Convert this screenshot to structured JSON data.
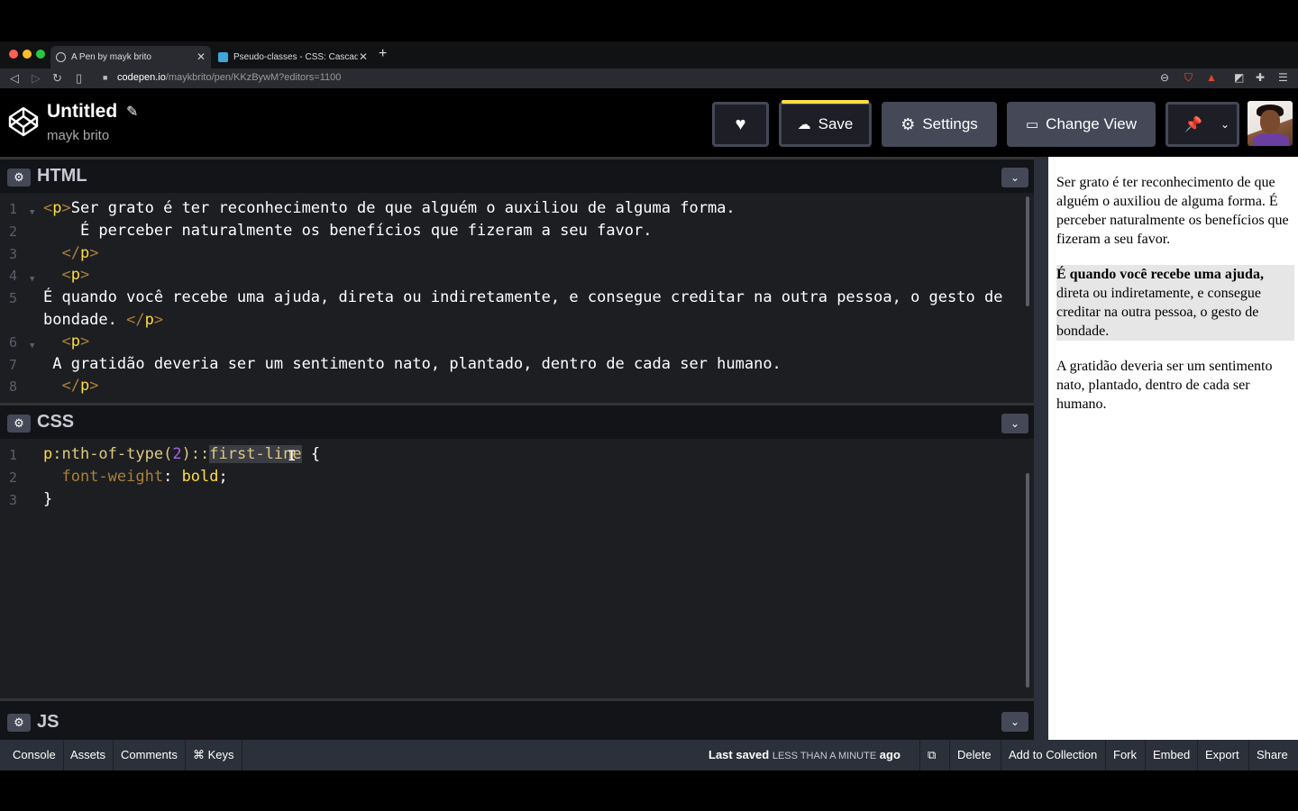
{
  "browser": {
    "tabs": [
      {
        "label": "A Pen by mayk brito",
        "close": "✕",
        "active": true
      },
      {
        "label": "Pseudo-classes - CSS: Cascading Style Sheets",
        "close": "✕",
        "active": false
      }
    ],
    "new_tab": "+",
    "url_host": "codepen.io",
    "url_path": "/maykbrito/pen/KKzBywM?editors=1100"
  },
  "header": {
    "title": "Untitled",
    "author": "mayk brito",
    "save_label": "Save",
    "settings_label": "Settings",
    "change_view_label": "Change View"
  },
  "html_panel": {
    "name": "HTML",
    "line_numbers": [
      "1",
      "2",
      "3",
      "4",
      "5",
      "",
      "6",
      "7",
      "8"
    ]
  },
  "css_panel": {
    "name": "CSS",
    "line_numbers": [
      "1",
      "2",
      "3"
    ]
  },
  "js_panel": {
    "name": "JS"
  },
  "preview": {
    "p1": "Ser grato é ter reconhecimento de que alguém o auxiliou de alguma forma. É perceber naturalmente os benefícios que fizeram a seu favor.",
    "p2_first": "É quando você recebe uma ajuda,",
    "p2_rest": "direta ou indiretamente, e consegue creditar na outra pessoa, o gesto de bondade.",
    "p3": "A gratidão deveria ser um sentimento nato, plantado, dentro de cada ser humano."
  },
  "footer": {
    "console": "Console",
    "assets": "Assets",
    "comments": "Comments",
    "keys": "⌘ Keys",
    "last_saved_prefix": "Last saved",
    "last_saved_caps": "LESS THAN A MINUTE",
    "last_saved_suffix": "ago",
    "delete": "Delete",
    "add_to_collection": "Add to Collection",
    "fork": "Fork",
    "embed": "Embed",
    "export": "Export",
    "share": "Share"
  },
  "colors": {
    "accent_yellow": "#ffdd40",
    "header_bg": "#000000",
    "editor_bg": "#1d1e22",
    "button_bg": "#444857"
  }
}
